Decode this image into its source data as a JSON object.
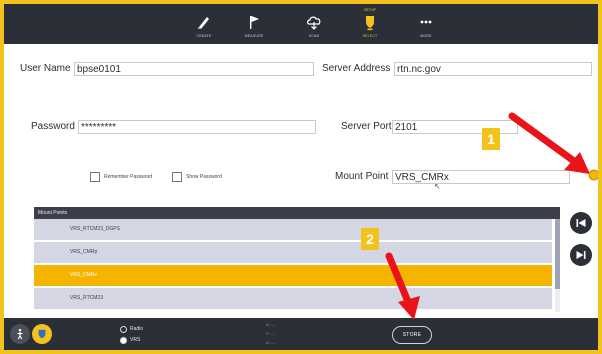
{
  "toolbar": {
    "items": [
      {
        "label": "CREATE",
        "icon": "pen-icon"
      },
      {
        "label": "MEASURE",
        "icon": "flag-icon"
      },
      {
        "label": "SCAN",
        "icon": "cloud-scan-icon"
      },
      {
        "label": "SELECT",
        "icon": "select-icon",
        "top_label": "SETUP"
      },
      {
        "label": "MORE",
        "icon": "more-icon"
      }
    ]
  },
  "form": {
    "username_label": "User Name",
    "username_value": "bpse0101",
    "server_address_label": "Server Address",
    "server_address_value": "rtn.nc.gov",
    "password_label": "Password",
    "password_value": "*********",
    "server_port_label": "Server Port",
    "server_port_value": "2101",
    "remember_password_label": "Remember Password",
    "show_password_label": "Show Password",
    "mount_point_label": "Mount Point",
    "mount_point_value": "VRS_CMRx"
  },
  "mount_points": {
    "header": "Mount Points",
    "items": [
      "VRS_RTCM23_DGPS",
      "VRS_CMRp",
      "VRS_CMRx",
      "VRS_RTCM23"
    ],
    "selected": "VRS_CMRx"
  },
  "bottom": {
    "radio_options": [
      "Radio",
      "VRS"
    ],
    "selected_radio": "VRS",
    "coords": [
      "X: ---",
      "Y: ---",
      "Z: ---"
    ],
    "store_label": "STORE"
  },
  "annotations": {
    "badge1": "1",
    "badge2": "2"
  },
  "colors": {
    "accent": "#f4c21c",
    "selected_row": "#f4b400",
    "toolbar_bg": "#2b2f38",
    "arrow": "#e8141a"
  }
}
